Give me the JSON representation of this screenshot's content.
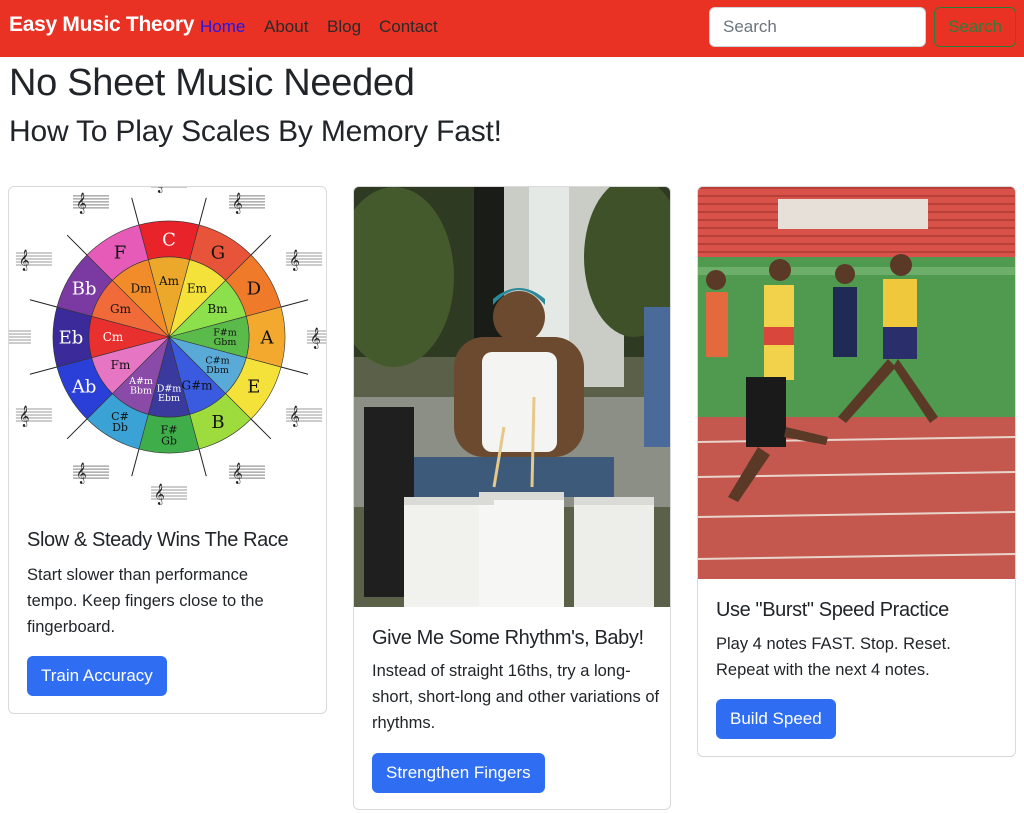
{
  "navbar": {
    "brand": "Easy Music Theory",
    "links": [
      "Home",
      "About",
      "Blog",
      "Contact"
    ],
    "search_placeholder": "Search",
    "search_button": "Search",
    "bg_color": "#ea3224",
    "active_link_color": "#2216e8"
  },
  "page": {
    "title": "No Sheet Music Needed",
    "subtitle": "How To Play Scales By Memory Fast!"
  },
  "cards": [
    {
      "image": "circle-of-fifths-diagram",
      "title": "Slow & Steady Wins The Race",
      "text": "Start slower than performance tempo. Keep fingers close to the fingerboard.",
      "button": "Train Accuracy"
    },
    {
      "image": "street-drummer-buckets-photo",
      "title": "Give Me Some Rhythm's, Baby!",
      "text": "Instead of straight 16ths, try a long-short, short-long and other variations of rhythms.",
      "button": "Strengthen Fingers"
    },
    {
      "image": "sprinters-on-track-photo",
      "title": "Use \"Burst\" Speed Practice",
      "text": "Play 4 notes FAST. Stop. Reset. Repeat with the next 4 notes.",
      "button": "Build Speed"
    }
  ],
  "circle": {
    "major": [
      "C",
      "G",
      "D",
      "A",
      "E",
      "B",
      "F#\nGb",
      "C#\nDb",
      "Ab",
      "Eb",
      "Bb",
      "F"
    ],
    "minor": [
      "Am",
      "Em",
      "Bm",
      "F#m\nGbm",
      "C#m\nDbm",
      "G#m",
      "D#m\nEbm",
      "A#m\nBbm",
      "Fm",
      "Cm",
      "Gm",
      "Dm"
    ]
  },
  "button_color": "#2f6ef2"
}
